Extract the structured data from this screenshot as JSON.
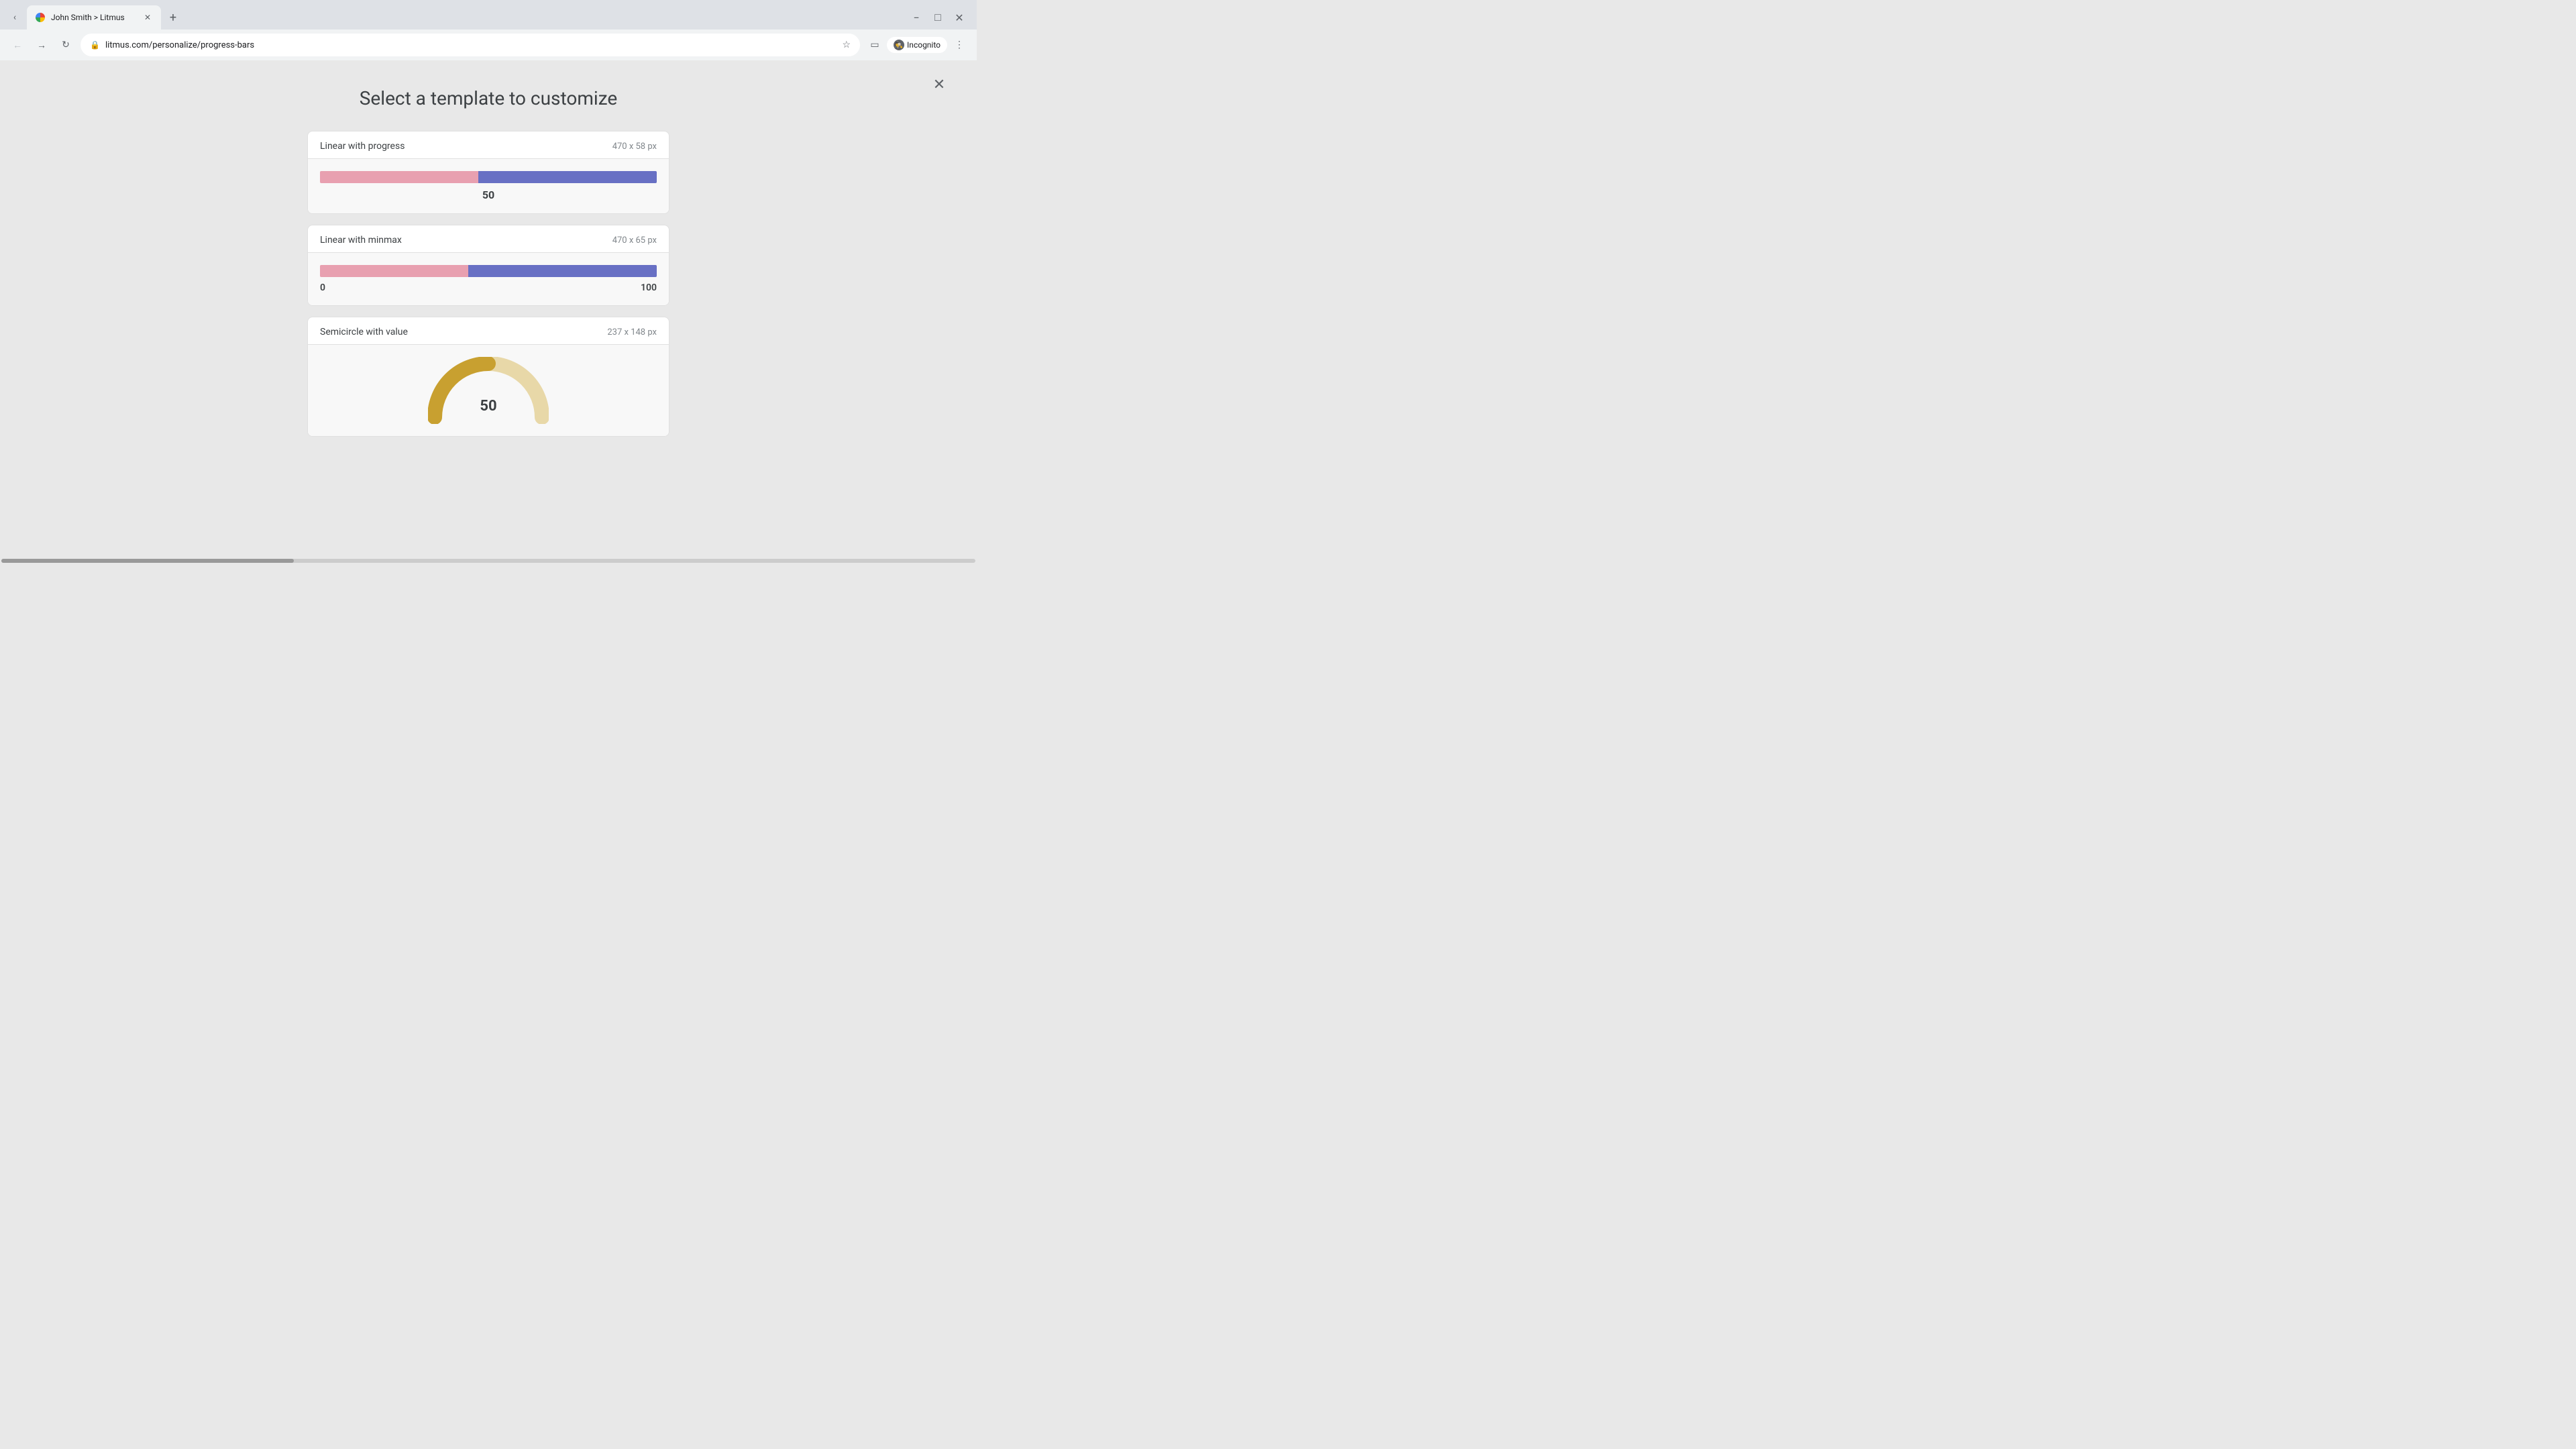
{
  "browser": {
    "tab_title": "John Smith > Litmus",
    "url": "litmus.com/personalize/progress-bars",
    "incognito_label": "Incognito"
  },
  "page": {
    "title": "Select a template to customize",
    "close_label": "×"
  },
  "templates": [
    {
      "id": "linear-progress",
      "name": "Linear with progress",
      "size": "470 x 58 px",
      "type": "linear",
      "value": "50",
      "filled_percent": 47,
      "show_value": true,
      "show_minmax": false
    },
    {
      "id": "linear-minmax",
      "name": "Linear with minmax",
      "size": "470 x 65 px",
      "type": "linear",
      "value": null,
      "filled_percent": 44,
      "show_value": false,
      "show_minmax": true,
      "min_label": "0",
      "max_label": "100"
    },
    {
      "id": "semicircle",
      "name": "Semicircle with value",
      "size": "237 x 148 px",
      "type": "semicircle",
      "value": "50"
    }
  ]
}
